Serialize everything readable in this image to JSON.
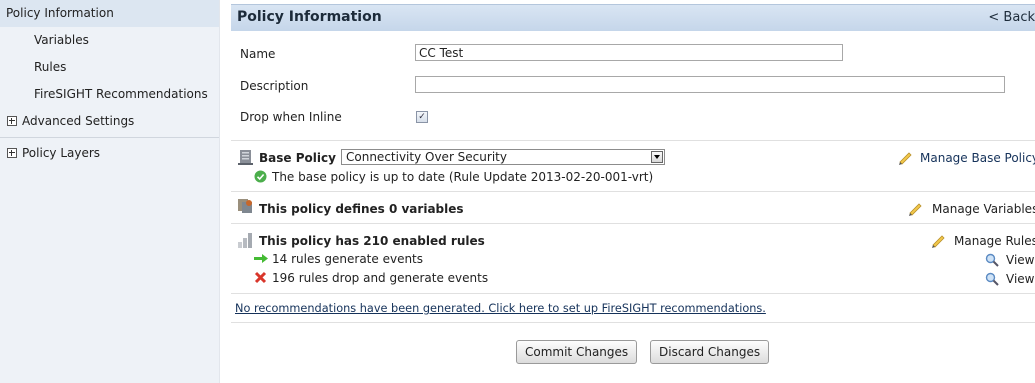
{
  "sidebar": {
    "items": [
      {
        "label": "Policy Information"
      },
      {
        "label": "Variables"
      },
      {
        "label": "Rules"
      },
      {
        "label": "FireSIGHT Recommendations"
      },
      {
        "label": "Advanced Settings"
      },
      {
        "label": "Policy Layers"
      }
    ]
  },
  "header": {
    "title": "Policy Information",
    "back": "< Back"
  },
  "form": {
    "name_label": "Name",
    "name_value": "CC Test",
    "description_label": "Description",
    "description_value": "",
    "drop_label": "Drop when Inline",
    "drop_checked": "✓"
  },
  "base_policy": {
    "label": "Base Policy",
    "selected": "Connectivity Over Security",
    "status": "The base policy is up to date (Rule Update 2013-02-20-001-vrt)",
    "manage": "Manage Base Policy"
  },
  "variables": {
    "summary": "This policy defines 0 variables",
    "manage": "Manage Variables"
  },
  "rules": {
    "summary": "This policy has 210 enabled rules",
    "manage": "Manage Rules",
    "generate": "14 rules generate events",
    "drop": "196 rules drop and generate events",
    "view": "View"
  },
  "recommendations_link": "No recommendations have been generated. Click here to set up FireSIGHT recommendations.",
  "buttons": {
    "commit": "Commit Changes",
    "discard": "Discard Changes"
  },
  "colors": {
    "header_bg": "#c9d9ec",
    "sidebar_bg": "#eef2f7",
    "ok_green": "#4cae4c",
    "drop_red": "#d9362b",
    "arrow_green": "#44bb33"
  }
}
